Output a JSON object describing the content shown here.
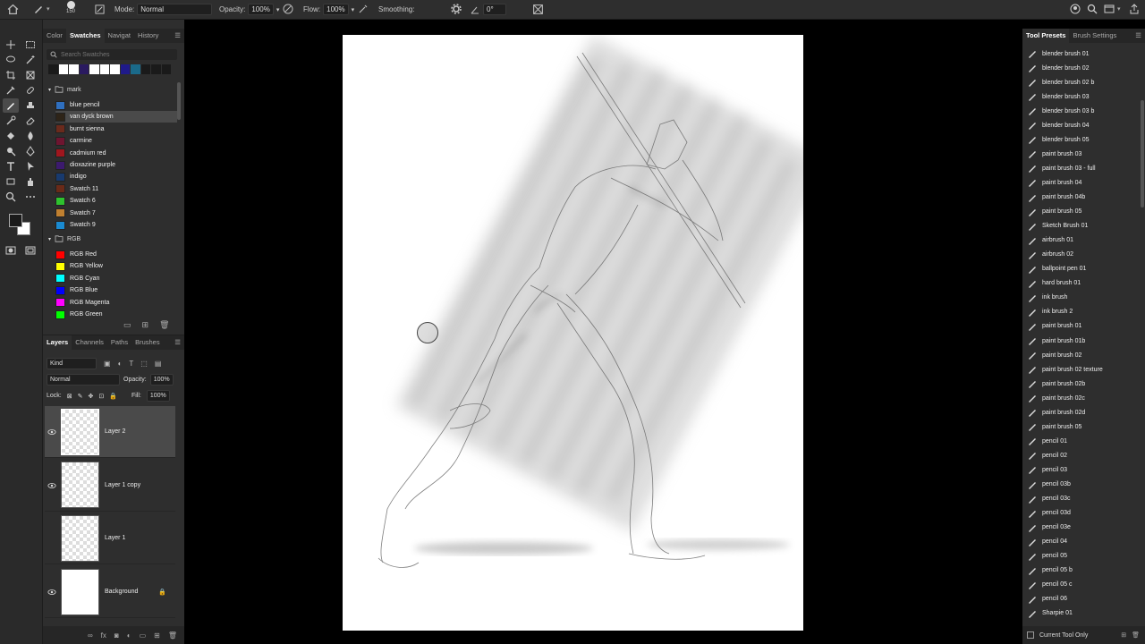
{
  "options_bar": {
    "brush_size": "150",
    "mode_label": "Mode:",
    "mode_value": "Normal",
    "opacity_label": "Opacity:",
    "opacity_value": "100%",
    "flow_label": "Flow:",
    "flow_value": "100%",
    "smoothing_label": "Smoothing:",
    "smoothing_value": "",
    "angle_value": "0°"
  },
  "swatches_panel": {
    "tabs": [
      "Color",
      "Swatches",
      "Navigat",
      "History"
    ],
    "active_tab": "Swatches",
    "search_placeholder": "Search Swatches",
    "recent": [
      "#1a1a1a",
      "#ffffff",
      "#ffffff",
      "#2a1a60",
      "#ffffff",
      "#ffffff",
      "#ffffff",
      "#1f1a8a",
      "#1a6a8a",
      "#1a1a1a",
      "#1a1a1a",
      "#1a1a1a"
    ],
    "group1_name": "mark",
    "group1": [
      {
        "name": "blue pencil",
        "color": "#2f6fbf"
      },
      {
        "name": "van dyck brown",
        "color": "#2e2418"
      },
      {
        "name": "burnt sienna",
        "color": "#6b2a1c"
      },
      {
        "name": "carmine",
        "color": "#6e1530"
      },
      {
        "name": "cadmium red",
        "color": "#a0161e"
      },
      {
        "name": "dioxazine purple",
        "color": "#3c1a6e"
      },
      {
        "name": "indigo",
        "color": "#183a6e"
      },
      {
        "name": "Swatch 11",
        "color": "#6a2a18"
      },
      {
        "name": "Swatch 6",
        "color": "#2ec22e"
      },
      {
        "name": "Swatch 7",
        "color": "#c08030"
      },
      {
        "name": "Swatch 9",
        "color": "#1a8ad0"
      }
    ],
    "group2_name": "RGB",
    "group2": [
      {
        "name": "RGB Red",
        "color": "#ff0000"
      },
      {
        "name": "RGB Yellow",
        "color": "#ffff00"
      },
      {
        "name": "RGB Cyan",
        "color": "#00ffff"
      },
      {
        "name": "RGB Blue",
        "color": "#0000ff"
      },
      {
        "name": "RGB Magenta",
        "color": "#ff00ff"
      },
      {
        "name": "RGB Green",
        "color": "#00ff00"
      }
    ]
  },
  "layers_panel": {
    "tabs": [
      "Layers",
      "Channels",
      "Paths",
      "Brushes"
    ],
    "filter_kind": "Kind",
    "blend_mode": "Normal",
    "opacity_label": "Opacity:",
    "opacity_value": "100%",
    "lock_label": "Lock:",
    "fill_label": "Fill:",
    "fill_value": "100%",
    "layers": [
      {
        "name": "Layer 2",
        "visible": true,
        "selected": true
      },
      {
        "name": "Layer 1 copy",
        "visible": true,
        "selected": false
      },
      {
        "name": "Layer 1",
        "visible": false,
        "selected": false
      },
      {
        "name": "Background",
        "visible": true,
        "selected": false,
        "locked": true
      }
    ]
  },
  "tool_presets_panel": {
    "tabs": [
      "Tool Presets",
      "Brush Settings"
    ],
    "presets": [
      "blender brush 01",
      "blender brush 02",
      "blender brush 02 b",
      "blender brush 03",
      "blender brush 03 b",
      "blender brush 04",
      "blender brush 05",
      "paint brush 03",
      "paint brush 03 - full",
      "paint brush 04",
      "paint brush 04b",
      "paint brush 05",
      "Sketch Brush 01",
      "airbrush 01",
      "airbrush 02",
      "ballpoint pen 01",
      "hard brush 01",
      "ink brush",
      "ink brush 2",
      "paint brush 01",
      "paint brush 01b",
      "paint brush 02",
      "paint brush 02 texture",
      "paint brush 02b",
      "paint brush 02c",
      "paint brush 02d",
      "paint brush 05",
      "pencil 01",
      "pencil 02",
      "pencil 03",
      "pencil 03b",
      "pencil 03c",
      "pencil 03d",
      "pencil 03e",
      "pencil 04",
      "pencil 05",
      "pencil 05 b",
      "pencil 05 c",
      "pencil 06",
      "Sharpie 01"
    ],
    "current_tool_only_label": "Current Tool Only"
  },
  "colors": {
    "panel_bg": "#2e2e2e",
    "selected_row": "#4a4a4a",
    "canvas_bg": "#000000",
    "document_bg": "#ffffff"
  }
}
